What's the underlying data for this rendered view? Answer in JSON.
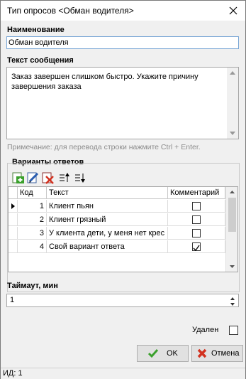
{
  "window": {
    "title": "Тип опросов <Обман водителя>"
  },
  "name_section": {
    "label": "Наименование",
    "value": "Обман водителя"
  },
  "message_section": {
    "label": "Текст сообщения",
    "line1": "Заказ завершен слишком быстро. Укажите причину",
    "line2": "завершения заказа"
  },
  "note": "Примечание: для перевода строки нажмите Ctrl + Enter.",
  "answers": {
    "label": "Варианты ответов",
    "toolbar": [
      "add-icon",
      "edit-icon",
      "delete-icon",
      "move-up-icon",
      "move-down-icon"
    ],
    "columns": {
      "code": "Код",
      "text": "Текст",
      "comment": "Комментарий"
    },
    "rows": [
      {
        "code": "1",
        "text": "Клиент пьян",
        "comment": false
      },
      {
        "code": "2",
        "text": "Клиент грязный",
        "comment": false
      },
      {
        "code": "3",
        "text": "У клиента дети, у меня нет крес",
        "comment": false
      },
      {
        "code": "4",
        "text": "Свой вариант ответа",
        "comment": true
      }
    ]
  },
  "timeout": {
    "label": "Таймаут, мин",
    "value": "1"
  },
  "deleted": {
    "label": "Удален",
    "checked": false
  },
  "buttons": {
    "ok": "OK",
    "cancel": "Отмена"
  },
  "status": {
    "id_text": "ИД: 1"
  },
  "colors": {
    "accent_border": "#7aa7d6",
    "ok_icon": "#3aa02c",
    "cancel_icon": "#d2311f"
  }
}
